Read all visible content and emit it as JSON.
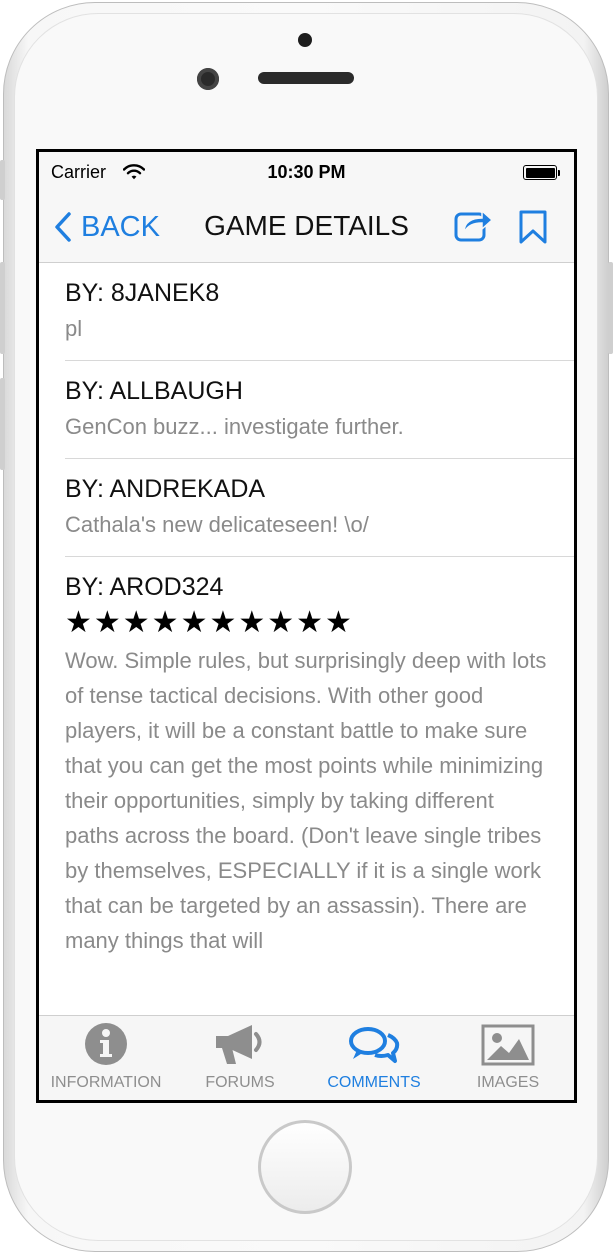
{
  "status_bar": {
    "carrier": "Carrier",
    "time": "10:30 PM"
  },
  "nav": {
    "back_label": "BACK",
    "title": "GAME DETAILS",
    "icons": [
      "share-icon",
      "bookmark-icon"
    ]
  },
  "colors": {
    "accent": "#1f7fe0",
    "body_text": "#8a8a8a",
    "tab_inactive": "#8e8e8e"
  },
  "comments": [
    {
      "by": "BY: 8JANEK8",
      "text": "pl"
    },
    {
      "by": "BY: ALLBAUGH",
      "text": "GenCon buzz... investigate further."
    },
    {
      "by": "BY: ANDREKADA",
      "text": "Cathala's new delicateseen! \\o/"
    },
    {
      "by": "BY: AROD324",
      "rating": 10,
      "stars": "★★★★★★★★★★",
      "text": "Wow. Simple rules, but surprisingly deep with lots of tense tactical decisions. With other good players, it will be a constant battle to make sure that you can get the most points while minimizing their opportunities, simply by taking different paths across the board. (Don't leave single tribes by themselves, ESPECIALLY if it is a single work that can be targeted by an assassin). There are many things that will"
    }
  ],
  "tabs": [
    {
      "label": "INFORMATION",
      "icon": "info-icon",
      "active": false
    },
    {
      "label": "FORUMS",
      "icon": "megaphone-icon",
      "active": false
    },
    {
      "label": "COMMENTS",
      "icon": "chat-bubbles-icon",
      "active": true
    },
    {
      "label": "IMAGES",
      "icon": "image-icon",
      "active": false
    }
  ]
}
